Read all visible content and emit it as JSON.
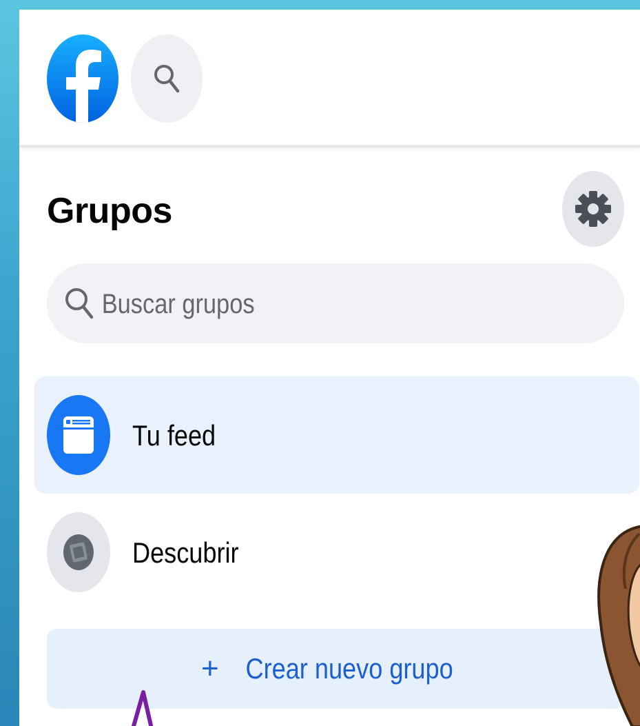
{
  "header": {
    "logo": "facebook-logo",
    "search_icon": "search-icon"
  },
  "groups": {
    "title": "Grupos",
    "settings_icon": "gear-icon",
    "search": {
      "placeholder": "Buscar grupos",
      "value": ""
    },
    "nav": [
      {
        "label": "Tu feed",
        "icon": "feed-icon",
        "active": true
      },
      {
        "label": "Descubrir",
        "icon": "compass-icon",
        "active": false
      }
    ],
    "create_button": {
      "plus": "+",
      "label": "Crear nuevo grupo"
    }
  },
  "colors": {
    "brand": "#1877f2",
    "accent_text": "#1b5fd0",
    "active_bg": "#e8f1fc",
    "create_bg": "#e6f0fb",
    "frame_bg": "#3ba5cf"
  }
}
